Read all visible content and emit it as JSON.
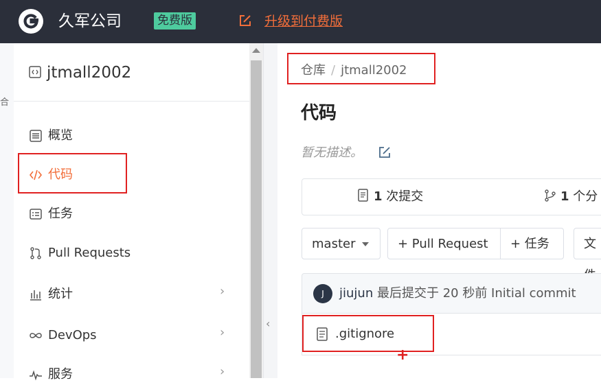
{
  "header": {
    "company": "久军公司",
    "plan_badge": "免费版",
    "upgrade_label": "升级到付费版",
    "brand_color": "#2b2f3a",
    "badge_color": "#4ecb9e",
    "accent_color": "#f26e3a"
  },
  "gutter": {
    "partial_text": "合"
  },
  "sidebar": {
    "repo_name": "jtmall2002",
    "items": [
      {
        "label": "概览",
        "icon": "overview-icon"
      },
      {
        "label": "代码",
        "icon": "code-icon",
        "active": true
      },
      {
        "label": "任务",
        "icon": "task-icon"
      },
      {
        "label": "Pull Requests",
        "icon": "pull-request-icon"
      },
      {
        "label": "统计",
        "icon": "chart-icon",
        "expandable": true
      },
      {
        "label": "DevOps",
        "icon": "infinity-icon",
        "expandable": true
      },
      {
        "label": "服务",
        "icon": "pulse-icon",
        "expandable": true
      }
    ]
  },
  "main": {
    "breadcrumb": {
      "root": "仓库",
      "separator": "/",
      "current": "jtmall2002"
    },
    "title": "代码",
    "description": "暂无描述。",
    "stats": {
      "commits_count": "1",
      "commits_label": "次提交",
      "branches_count": "1",
      "branches_label": "个分"
    },
    "toolbar": {
      "branch": "master",
      "pull_request": "+ Pull Request",
      "task": "+ 任务",
      "file": "文件"
    },
    "last_commit": {
      "avatar_initial": "J",
      "user": "jiujun",
      "text": "最后提交于 20 秒前 Initial commit"
    },
    "files": [
      {
        "name": ".gitignore",
        "icon": "file-icon"
      }
    ]
  }
}
